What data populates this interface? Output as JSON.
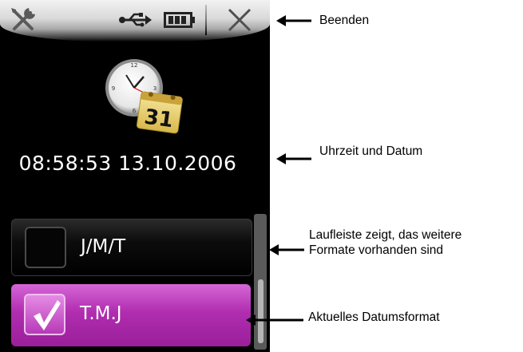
{
  "statusbar": {
    "icons": {
      "tools": "tools-icon",
      "usb": "usb-icon",
      "battery": "battery-icon",
      "close": "close-icon"
    }
  },
  "clock": {
    "calendar_day": "31",
    "datetime": "08:58:53 13.10.2006"
  },
  "formats": [
    {
      "label": "J/M/T",
      "checked": false
    },
    {
      "label": "T.M.J",
      "checked": true
    }
  ],
  "annotations": {
    "quit": "Beenden",
    "time_date": "Uhrzeit und Datum",
    "scroll_line1": "Laufleiste zeigt, das weitere",
    "scroll_line2": "Formate vorhanden sind",
    "current_format": "Aktuelles Datumsformat"
  },
  "colors": {
    "screen_bg": "#000000",
    "selected_item": "#b02db0",
    "text": "#ffffff"
  }
}
